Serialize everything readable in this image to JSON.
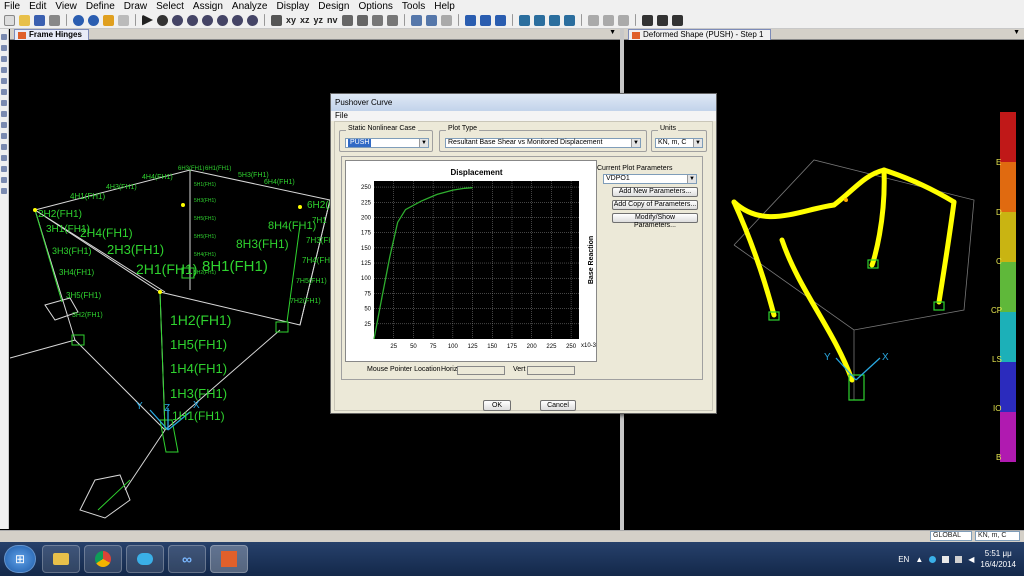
{
  "menu": [
    "File",
    "Edit",
    "View",
    "Define",
    "Draw",
    "Select",
    "Assign",
    "Analyze",
    "Display",
    "Design",
    "Options",
    "Tools",
    "Help"
  ],
  "toolbar": {
    "xy": "xy",
    "xz": "xz",
    "yz": "yz",
    "nv": "nv",
    "threed": "3-d"
  },
  "left_pane": {
    "tab_title": "Frame Hinges",
    "hinge_labels": [
      "6H3(FH1)",
      "6H1(FH1)",
      "5H3(FH1)",
      "6H4(FH1)",
      "4H4(FH1)",
      "4H3(FH1)",
      "4H1(FH1)",
      "5H1(FH1)",
      "5H3(FH1)",
      "5H5(FH1)",
      "5H5(FH1)",
      "5H4(FH1)",
      "5H2(FH1)",
      "2H2(FH1)",
      "3H1(FH1)",
      "2H4(FH1)",
      "3H3(FH1)",
      "2H3(FH1)",
      "2H1(FH1)",
      "3H4(FH1)",
      "3H5(FH1)",
      "3H2(FH1)",
      "8H3(FH1)",
      "8H1(FH1)",
      "8H4(FH1)",
      "6H2(FH1)",
      "7H1",
      "7H3(FH1)",
      "7H4(FH1)",
      "7H5(FH1)",
      "7H2(FH1)",
      "1H2(FH1)",
      "1H5(FH1)",
      "1H4(FH1)",
      "1H3(FH1)",
      "1H1(FH1)"
    ],
    "axis": {
      "y": "Y",
      "z": "Z",
      "x": "X"
    }
  },
  "right_pane": {
    "tab_title": "Deformed Shape (PUSH) - Step 1",
    "axis": {
      "y": "Y",
      "x": "X"
    },
    "legend": [
      {
        "label": "E",
        "color": "#c01818"
      },
      {
        "label": "D",
        "color": "#e06a10"
      },
      {
        "label": "C",
        "color": "#c9b412"
      },
      {
        "label": "CP",
        "color": "#5fb83a"
      },
      {
        "label": "LS",
        "color": "#1cb0b8"
      },
      {
        "label": "IO",
        "color": "#2b2bbd"
      },
      {
        "label": "B",
        "color": "#b01ab0"
      }
    ]
  },
  "dialog": {
    "title": "Pushover Curve",
    "menu_file": "File",
    "static_case_label": "Static Nonlinear Case",
    "static_case_value": "PUSH",
    "plot_type_label": "Plot Type",
    "plot_type_value": "Resultant Base Shear vs Monitored Displacement",
    "units_label": "Units",
    "units_value": "KN, m, C",
    "current_params_label": "Current Plot Parameters",
    "current_params_value": "VDPO1",
    "btn_add_new": "Add New Parameters...",
    "btn_add_copy": "Add Copy of Parameters...",
    "btn_modify": "Modify/Show Parameters...",
    "mouse_pointer_label": "Mouse Pointer Location",
    "horiz_label": "Horiz",
    "vert_label": "Vert",
    "ok": "OK",
    "cancel": "Cancel"
  },
  "status": {
    "coord_system": "GLOBAL",
    "units": "KN, m, C"
  },
  "tray": {
    "lang": "EN",
    "time": "5:51 μμ",
    "date": "16/4/2014"
  },
  "colors": {
    "hinge_green": "#2fd32f",
    "deformed_yellow": "#ffff00",
    "curve_green": "#2fae2f"
  },
  "chart_data": {
    "type": "line",
    "title": "Displacement",
    "xlabel": "",
    "ylabel": "Base Reaction",
    "x_multiplier_label": "x10-3",
    "xlim": [
      0,
      260
    ],
    "ylim": [
      0,
      260
    ],
    "xticks": [
      25,
      50,
      75,
      100,
      125,
      150,
      175,
      200,
      225,
      250
    ],
    "yticks": [
      25,
      50,
      75,
      100,
      125,
      150,
      175,
      200,
      225,
      250
    ],
    "grid": true,
    "series": [
      {
        "x": [
          0,
          10,
          20,
          30,
          40,
          60,
          80,
          100,
          115,
          125
        ],
        "y": [
          0,
          68,
          135,
          192,
          213,
          227,
          238,
          245,
          248,
          249
        ]
      }
    ]
  }
}
